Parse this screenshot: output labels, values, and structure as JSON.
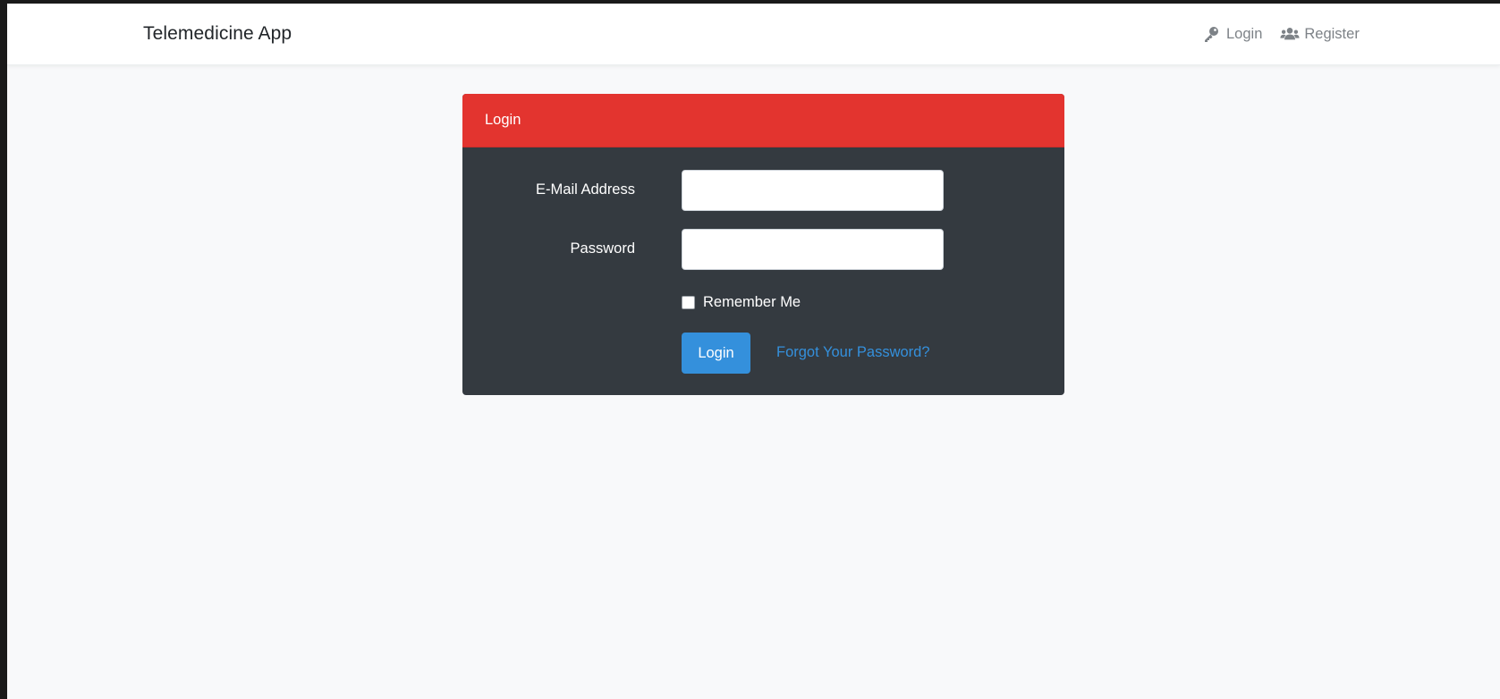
{
  "navbar": {
    "brand": "Telemedicine App",
    "links": [
      {
        "label": "Login",
        "icon": "key-icon"
      },
      {
        "label": "Register",
        "icon": "users-icon"
      }
    ]
  },
  "login_card": {
    "header": "Login",
    "email": {
      "label": "E-Mail Address",
      "value": "",
      "placeholder": ""
    },
    "password": {
      "label": "Password",
      "value": "",
      "placeholder": ""
    },
    "remember_me": {
      "label": "Remember Me",
      "checked": false
    },
    "submit_label": "Login",
    "forgot_password": "Forgot Your Password?"
  },
  "colors": {
    "header_bg": "#e3342f",
    "card_bg": "#343a40",
    "primary": "#3490dc",
    "page_bg": "#f8f9fa",
    "nav_text": "#7d8287"
  }
}
